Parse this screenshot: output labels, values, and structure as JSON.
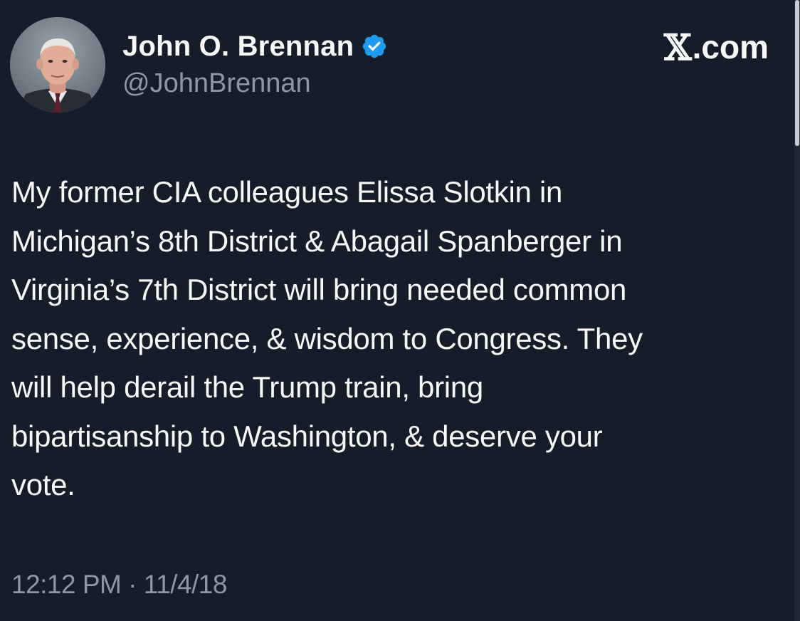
{
  "author": {
    "display_name": "John O. Brennan",
    "handle": "@JohnBrennan",
    "verified_icon": "verified-badge-icon",
    "avatar": "profile-photo"
  },
  "brand": {
    "label": ".com",
    "mark": "𝕏"
  },
  "tweet": {
    "text": "My former CIA colleagues Elissa Slotkin in\nMichigan’s 8th District & Abagail Spanberger in\nVirginia’s 7th District will bring needed common\nsense, experience, & wisdom to Congress. They\nwill help derail the Trump train, bring\nbipartisanship to Washington, & deserve your\nvote.",
    "timestamp": "12:12 PM · 11/4/18"
  },
  "colors": {
    "background": "#161d2a",
    "text": "#f7f9f9",
    "secondary_text": "#8b98a5",
    "verified": "#1d9bf0"
  }
}
